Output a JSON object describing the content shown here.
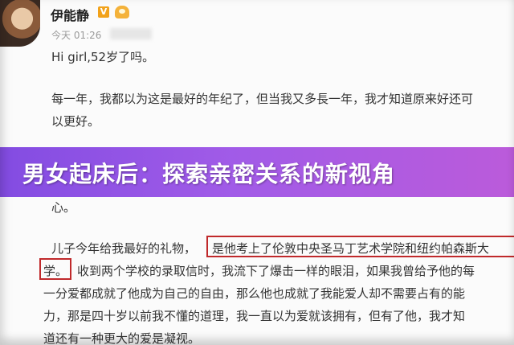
{
  "post": {
    "username": "伊能静",
    "verified_badge": "V",
    "timestamp": "今天 01:26",
    "lines": {
      "l1": "Hi girl,52岁了吗。",
      "l2": "每一年，我都以为这是最好的年纪了，但当我又多長一年，我才知道原来好还可",
      "l3": "以更好。",
      "l4": "心。",
      "l5a": "儿子今年给我最好的礼物，",
      "l5b": "是他考上了伦敦中央圣马丁艺术学院和纽约帕森斯大",
      "l6a": "学。",
      "l6b": "收到两个学校的录取信时，我流下了爆击一样的眼泪，如果我曾给予他的每",
      "l7": "一分爱都成就了他成为自己的自由，那么他也成就了我能爱人却不需要占有的能",
      "l8": "力，那是四十岁以前我不懂的道理，我一直以为爱就该拥有，但有了他，我才知",
      "l9": "道还有一种更大的爱是凝视。"
    }
  },
  "overlay": {
    "title": "男女起床后：探索亲密关系的新视角"
  },
  "icons": {
    "member": "member-crown-icon"
  }
}
